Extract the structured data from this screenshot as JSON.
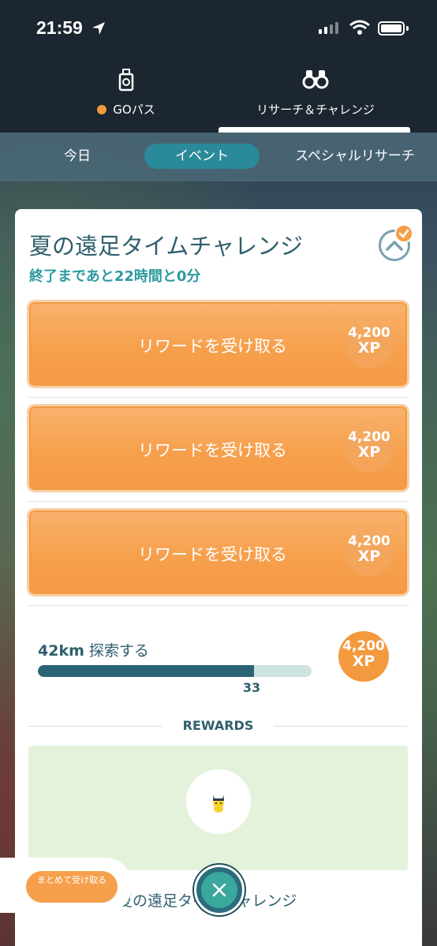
{
  "status_bar": {
    "time": "21:59"
  },
  "top_nav": {
    "tabs": [
      {
        "label": "GOパス",
        "icon": "go-pass-icon",
        "active": false
      },
      {
        "label": "リサーチ＆チャレンジ",
        "icon": "binoculars-icon",
        "active": true
      }
    ]
  },
  "sub_tabs": [
    {
      "label": "今日",
      "active": false
    },
    {
      "label": "イベント",
      "active": true
    },
    {
      "label": "スペシャルリサーチ",
      "active": false
    }
  ],
  "challenge": {
    "title": "夏の遠足タイムチャレンジ",
    "time_left": "終了まであと22時間と0分",
    "reward_buttons": [
      {
        "label": "リワードを受け取る",
        "xp_amount": "4,200",
        "xp_unit": "XP"
      },
      {
        "label": "リワードを受け取る",
        "xp_amount": "4,200",
        "xp_unit": "XP"
      },
      {
        "label": "リワードを受け取る",
        "xp_amount": "4,200",
        "xp_unit": "XP"
      }
    ],
    "task": {
      "distance": "42km",
      "label": "探索する",
      "progress_value": "33",
      "progress_fraction": 0.79,
      "xp_amount": "4,200",
      "xp_unit": "XP"
    },
    "rewards_heading": "REWARDS",
    "footer_title": "夏の遠足タイムチャレンジ"
  },
  "bulk_claim_label": "まとめて受け取る",
  "colors": {
    "accent_orange": "#f6a04d",
    "teal": "#2b6575",
    "title_text": "#2f5f6e"
  }
}
